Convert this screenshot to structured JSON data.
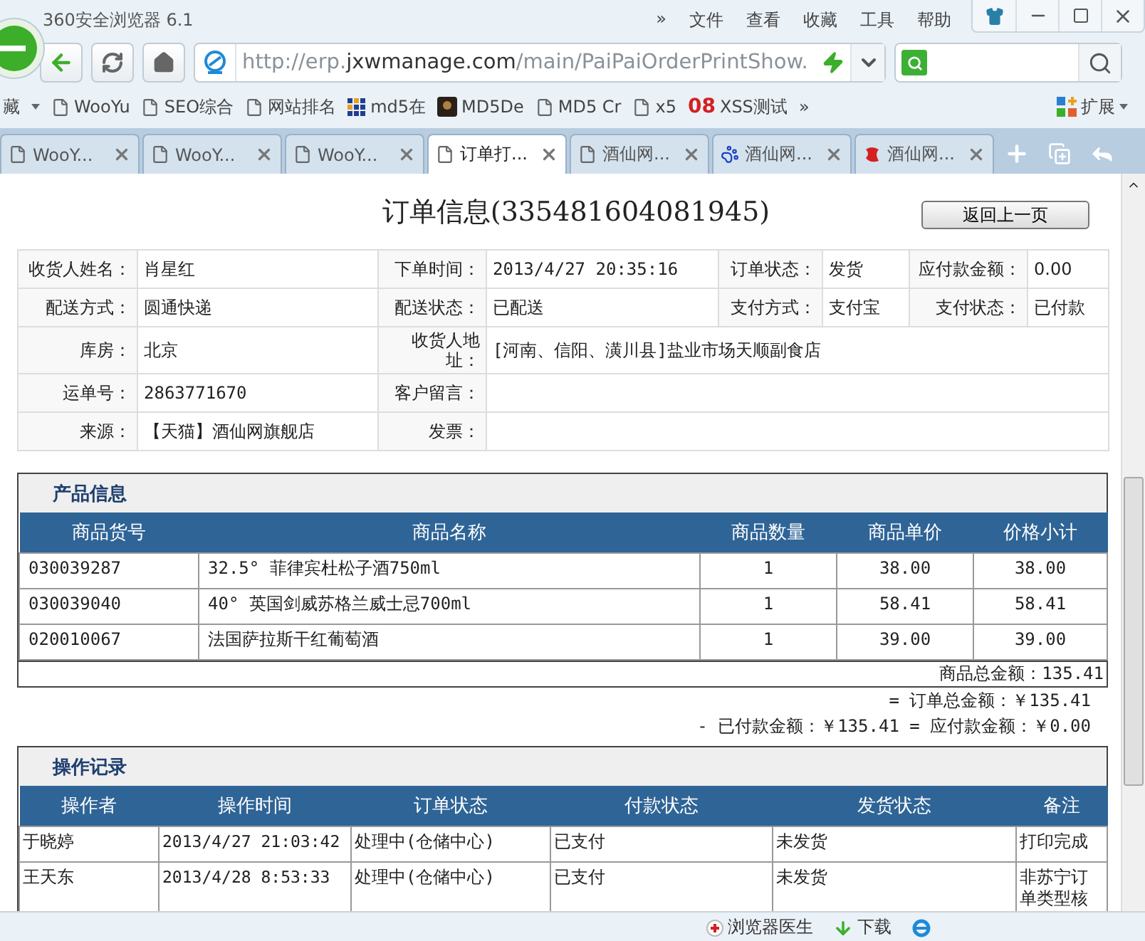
{
  "browser": {
    "title": "360安全浏览器 6.1",
    "menu": [
      "»",
      "文件",
      "查看",
      "收藏",
      "工具",
      "帮助"
    ],
    "url_prefix": "http://erp.",
    "url_host": "jxwmanage.com",
    "url_path": "/main/PaiPaiOrderPrintShow.",
    "favorites_label": "藏",
    "bookmarks": [
      {
        "label": "WooYu",
        "kind": "page"
      },
      {
        "label": "SEO综合",
        "kind": "page"
      },
      {
        "label": "网站排名",
        "kind": "page"
      },
      {
        "label": "md5在",
        "kind": "grid"
      },
      {
        "label": "MD5De",
        "kind": "photo"
      },
      {
        "label": "MD5 Cr",
        "kind": "page"
      },
      {
        "label": "x5",
        "kind": "page"
      },
      {
        "label": "XSS测试",
        "kind": "mark",
        "mark": "08"
      }
    ],
    "more": "»",
    "extensions": "扩展",
    "tabs": [
      {
        "label": "WooY...",
        "kind": "page",
        "selected": false
      },
      {
        "label": "WooY...",
        "kind": "page",
        "selected": false
      },
      {
        "label": "WooY...",
        "kind": "page",
        "selected": false
      },
      {
        "label": "订单打...",
        "kind": "page",
        "selected": true
      },
      {
        "label": "酒仙网...",
        "kind": "page",
        "selected": false
      },
      {
        "label": "酒仙网...",
        "kind": "paw",
        "selected": false
      },
      {
        "label": "酒仙网...",
        "kind": "logo",
        "selected": false
      }
    ],
    "status_items": [
      "浏览器医生",
      "下载"
    ]
  },
  "page": {
    "title": "订单信息(335481604081945)",
    "back_button": "返回上一页",
    "info_rows": [
      [
        "收货人姓名：",
        "肖星红",
        "下单时间：",
        "2013/4/27 20:35:16",
        "订单状态：",
        "发货",
        "应付款金额：",
        "0.00"
      ],
      [
        "配送方式：",
        "圆通快递",
        "配送状态：",
        "已配送",
        "支付方式：",
        "支付宝",
        "支付状态：",
        "已付款"
      ],
      [
        "库房：",
        "北京",
        "收货人地址：",
        "[河南、信阳、潢川县]盐业市场天顺副食店"
      ],
      [
        "运单号：",
        "2863771670",
        "客户留言：",
        ""
      ],
      [
        "来源：",
        "【天猫】酒仙网旗舰店",
        "发票：",
        ""
      ]
    ],
    "products": {
      "heading": "产品信息",
      "columns": [
        "商品货号",
        "商品名称",
        "商品数量",
        "商品单价",
        "价格小计"
      ],
      "rows": [
        [
          "030039287",
          "32.5° 菲律宾杜松子酒750ml",
          "1",
          "38.00",
          "38.00"
        ],
        [
          "030039040",
          "40° 英国剑威苏格兰威士忌700ml",
          "1",
          "58.41",
          "58.41"
        ],
        [
          "020010067",
          "法国萨拉斯干红葡萄酒",
          "1",
          "39.00",
          "39.00"
        ]
      ],
      "total": "商品总金额：135.41",
      "order_total": "= 订单总金额：￥135.41",
      "payment_line": "- 已付款金额：￥135.41 = 应付款金额：￥0.00"
    },
    "operations": {
      "heading": "操作记录",
      "columns": [
        "操作者",
        "操作时间",
        "订单状态",
        "付款状态",
        "发货状态",
        "备注"
      ],
      "rows": [
        [
          "于晓婷",
          "2013/4/27 21:03:42",
          "处理中(仓储中心)",
          "已支付",
          "未发货",
          "打印完成"
        ],
        [
          "王天东",
          "2013/4/28 8:53:33",
          "处理中(仓储中心)",
          "已支付",
          "未发货",
          "非苏宁订单类型核"
        ]
      ]
    }
  }
}
